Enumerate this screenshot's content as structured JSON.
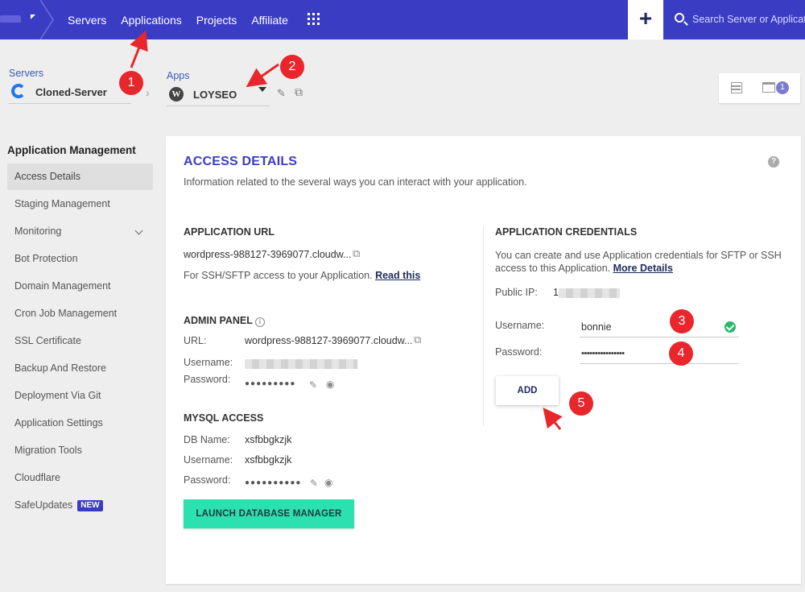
{
  "topbar": {
    "nav": [
      "Servers",
      "Applications",
      "Projects",
      "Affiliate"
    ],
    "plus": "+",
    "search_placeholder": "Search Server or Application"
  },
  "breadcrumb": {
    "servers_label": "Servers",
    "server_name": "Cloned-Server",
    "separator": "›",
    "apps_label": "Apps",
    "app_name": "LOYSEO",
    "wp_glyph": "W",
    "file_badge": "1"
  },
  "sidebar": {
    "title": "Application Management",
    "items": [
      "Access Details",
      "Staging Management",
      "Monitoring",
      "Bot Protection",
      "Domain Management",
      "Cron Job Management",
      "SSL Certificate",
      "Backup And Restore",
      "Deployment Via Git",
      "Application Settings",
      "Migration Tools",
      "Cloudflare",
      "SafeUpdates"
    ],
    "new_badge": "NEW"
  },
  "card": {
    "title": "ACCESS DETAILS",
    "description": "Information related to the several ways you can interact with your application.",
    "help": "?",
    "app_url": {
      "title": "APPLICATION URL",
      "url": "wordpress-988127-3969077.cloudw...",
      "note": "For SSH/SFTP access to your Application.",
      "note_link": "Read this"
    },
    "admin": {
      "title": "ADMIN PANEL",
      "info": "i",
      "url_label": "URL:",
      "url": "wordpress-988127-3969077.cloudw...",
      "username_label": "Username:",
      "password_label": "Password:",
      "password": "●●●●●●●●●"
    },
    "mysql": {
      "title": "MYSQL ACCESS",
      "db_label": "DB Name:",
      "db": "xsfbbgkzjk",
      "username_label": "Username:",
      "username": "xsfbbgkzjk",
      "password_label": "Password:",
      "password": "●●●●●●●●●●",
      "launch": "LAUNCH DATABASE MANAGER"
    },
    "credentials": {
      "title": "APPLICATION CREDENTIALS",
      "desc_line1": "You can create and use Application credentials for SFTP or SSH",
      "desc_line2": "access to this Application.",
      "more": "More Details",
      "ip_label": "Public IP:",
      "ip_prefix": "1",
      "username_label": "Username:",
      "username": "bonnie",
      "password_label": "Password:",
      "password": "••••••••••••••••",
      "add": "ADD"
    }
  },
  "annotations": [
    "1",
    "2",
    "3",
    "4",
    "5"
  ],
  "colors": {
    "topbar": "#3b3cc4",
    "accent": "#3b3cc4",
    "launch": "#2de0b0",
    "annotation": "#e8262b",
    "success": "#2ab96b"
  }
}
